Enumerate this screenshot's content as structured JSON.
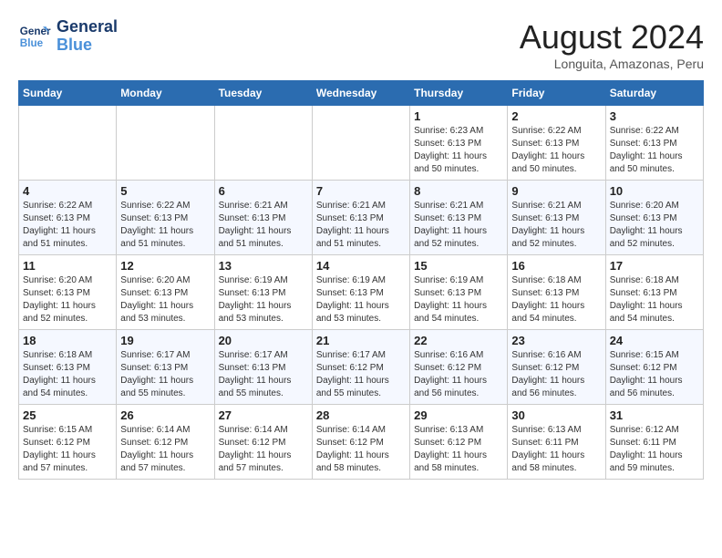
{
  "header": {
    "logo_line1": "General",
    "logo_line2": "Blue",
    "month_year": "August 2024",
    "location": "Longuita, Amazonas, Peru"
  },
  "days_of_week": [
    "Sunday",
    "Monday",
    "Tuesday",
    "Wednesday",
    "Thursday",
    "Friday",
    "Saturday"
  ],
  "weeks": [
    [
      {
        "day": "",
        "info": ""
      },
      {
        "day": "",
        "info": ""
      },
      {
        "day": "",
        "info": ""
      },
      {
        "day": "",
        "info": ""
      },
      {
        "day": "1",
        "info": "Sunrise: 6:23 AM\nSunset: 6:13 PM\nDaylight: 11 hours and 50 minutes."
      },
      {
        "day": "2",
        "info": "Sunrise: 6:22 AM\nSunset: 6:13 PM\nDaylight: 11 hours and 50 minutes."
      },
      {
        "day": "3",
        "info": "Sunrise: 6:22 AM\nSunset: 6:13 PM\nDaylight: 11 hours and 50 minutes."
      }
    ],
    [
      {
        "day": "4",
        "info": "Sunrise: 6:22 AM\nSunset: 6:13 PM\nDaylight: 11 hours and 51 minutes."
      },
      {
        "day": "5",
        "info": "Sunrise: 6:22 AM\nSunset: 6:13 PM\nDaylight: 11 hours and 51 minutes."
      },
      {
        "day": "6",
        "info": "Sunrise: 6:21 AM\nSunset: 6:13 PM\nDaylight: 11 hours and 51 minutes."
      },
      {
        "day": "7",
        "info": "Sunrise: 6:21 AM\nSunset: 6:13 PM\nDaylight: 11 hours and 51 minutes."
      },
      {
        "day": "8",
        "info": "Sunrise: 6:21 AM\nSunset: 6:13 PM\nDaylight: 11 hours and 52 minutes."
      },
      {
        "day": "9",
        "info": "Sunrise: 6:21 AM\nSunset: 6:13 PM\nDaylight: 11 hours and 52 minutes."
      },
      {
        "day": "10",
        "info": "Sunrise: 6:20 AM\nSunset: 6:13 PM\nDaylight: 11 hours and 52 minutes."
      }
    ],
    [
      {
        "day": "11",
        "info": "Sunrise: 6:20 AM\nSunset: 6:13 PM\nDaylight: 11 hours and 52 minutes."
      },
      {
        "day": "12",
        "info": "Sunrise: 6:20 AM\nSunset: 6:13 PM\nDaylight: 11 hours and 53 minutes."
      },
      {
        "day": "13",
        "info": "Sunrise: 6:19 AM\nSunset: 6:13 PM\nDaylight: 11 hours and 53 minutes."
      },
      {
        "day": "14",
        "info": "Sunrise: 6:19 AM\nSunset: 6:13 PM\nDaylight: 11 hours and 53 minutes."
      },
      {
        "day": "15",
        "info": "Sunrise: 6:19 AM\nSunset: 6:13 PM\nDaylight: 11 hours and 54 minutes."
      },
      {
        "day": "16",
        "info": "Sunrise: 6:18 AM\nSunset: 6:13 PM\nDaylight: 11 hours and 54 minutes."
      },
      {
        "day": "17",
        "info": "Sunrise: 6:18 AM\nSunset: 6:13 PM\nDaylight: 11 hours and 54 minutes."
      }
    ],
    [
      {
        "day": "18",
        "info": "Sunrise: 6:18 AM\nSunset: 6:13 PM\nDaylight: 11 hours and 54 minutes."
      },
      {
        "day": "19",
        "info": "Sunrise: 6:17 AM\nSunset: 6:13 PM\nDaylight: 11 hours and 55 minutes."
      },
      {
        "day": "20",
        "info": "Sunrise: 6:17 AM\nSunset: 6:13 PM\nDaylight: 11 hours and 55 minutes."
      },
      {
        "day": "21",
        "info": "Sunrise: 6:17 AM\nSunset: 6:12 PM\nDaylight: 11 hours and 55 minutes."
      },
      {
        "day": "22",
        "info": "Sunrise: 6:16 AM\nSunset: 6:12 PM\nDaylight: 11 hours and 56 minutes."
      },
      {
        "day": "23",
        "info": "Sunrise: 6:16 AM\nSunset: 6:12 PM\nDaylight: 11 hours and 56 minutes."
      },
      {
        "day": "24",
        "info": "Sunrise: 6:15 AM\nSunset: 6:12 PM\nDaylight: 11 hours and 56 minutes."
      }
    ],
    [
      {
        "day": "25",
        "info": "Sunrise: 6:15 AM\nSunset: 6:12 PM\nDaylight: 11 hours and 57 minutes."
      },
      {
        "day": "26",
        "info": "Sunrise: 6:14 AM\nSunset: 6:12 PM\nDaylight: 11 hours and 57 minutes."
      },
      {
        "day": "27",
        "info": "Sunrise: 6:14 AM\nSunset: 6:12 PM\nDaylight: 11 hours and 57 minutes."
      },
      {
        "day": "28",
        "info": "Sunrise: 6:14 AM\nSunset: 6:12 PM\nDaylight: 11 hours and 58 minutes."
      },
      {
        "day": "29",
        "info": "Sunrise: 6:13 AM\nSunset: 6:12 PM\nDaylight: 11 hours and 58 minutes."
      },
      {
        "day": "30",
        "info": "Sunrise: 6:13 AM\nSunset: 6:11 PM\nDaylight: 11 hours and 58 minutes."
      },
      {
        "day": "31",
        "info": "Sunrise: 6:12 AM\nSunset: 6:11 PM\nDaylight: 11 hours and 59 minutes."
      }
    ]
  ]
}
